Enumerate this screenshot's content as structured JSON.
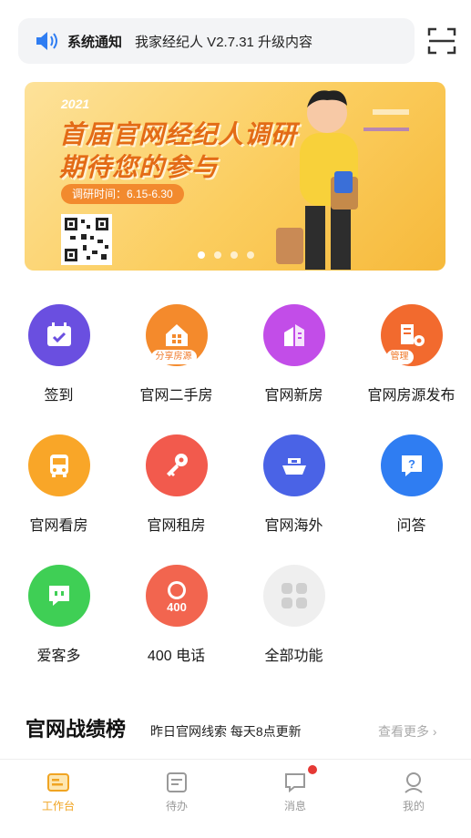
{
  "notice": {
    "title": "系统通知",
    "message": "我家经纪人 V2.7.31 升级内容"
  },
  "banner": {
    "year": "2021",
    "line1": "首届官网经纪人调研",
    "line2": "期待您的参与",
    "date": "调研时间：6.15-6.30"
  },
  "grid": [
    {
      "label": "签到",
      "color": "#6a4fe0",
      "sub": ""
    },
    {
      "label": "官网二手房",
      "color": "#f48a2c",
      "sub": "分享房源"
    },
    {
      "label": "官网新房",
      "color": "#c24de8",
      "sub": ""
    },
    {
      "label": "官网房源发布",
      "color": "#f26a2e",
      "sub": "管理"
    },
    {
      "label": "官网看房",
      "color": "#f9a628",
      "sub": ""
    },
    {
      "label": "官网租房",
      "color": "#f25a4d",
      "sub": ""
    },
    {
      "label": "官网海外",
      "color": "#4a63e6",
      "sub": ""
    },
    {
      "label": "问答",
      "color": "#2f7df2",
      "sub": ""
    },
    {
      "label": "爱客多",
      "color": "#3fcf55",
      "sub": ""
    },
    {
      "label": "400 电话",
      "color": "#f2654f",
      "sub": ""
    },
    {
      "label": "全部功能",
      "color": "#efefef",
      "sub": ""
    }
  ],
  "rank": {
    "title": "官网战绩榜",
    "subtitle": "昨日官网线索 每天8点更新",
    "more": "查看更多 ›"
  },
  "tabs": [
    {
      "label": "工作台"
    },
    {
      "label": "待办"
    },
    {
      "label": "消息"
    },
    {
      "label": "我的"
    }
  ],
  "colors": {
    "accent": "#f0a422",
    "badge": "#e53935"
  }
}
